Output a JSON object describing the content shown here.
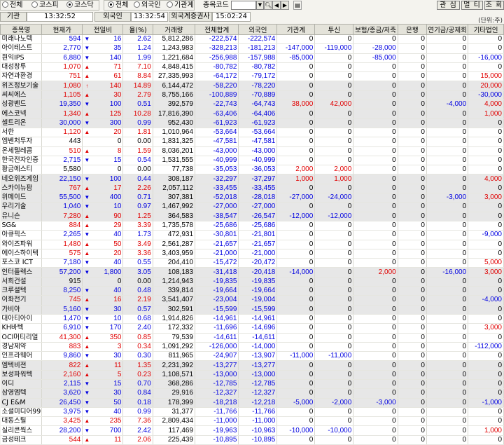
{
  "toolbar": {
    "market_options": [
      "전체",
      "코스피",
      "코스닥"
    ],
    "market_selected": 2,
    "investor_options": [
      "전체",
      "외국인",
      "기관계"
    ],
    "investor_selected": 0,
    "code_label": "종목코드",
    "code_value": "",
    "buttons": [
      "관 심",
      "멀 티",
      "조 회"
    ]
  },
  "timebar": {
    "inst_label": "기관",
    "inst_time": "13:32:52",
    "foreign_label": "외국인",
    "foreign_time": "13:32:54",
    "broker_label": "외국계증권사",
    "broker_time": "15:02:24"
  },
  "unit_label": "(단위:주)",
  "columns": [
    "종목명",
    "현재가",
    "전일비",
    "율(%)",
    "거래량",
    "전체합계",
    "외국인",
    "기관계",
    "투신",
    "보험/종금/저축",
    "은행",
    "연기금/공제회",
    "기타법인"
  ],
  "rows": [
    {
      "name": "미래나노텍",
      "price": "594",
      "dir": "down",
      "chg": "16",
      "rate": "2.62",
      "vol": "5,812,286",
      "total": "-222,574",
      "foreign": "-222,574",
      "inst": "0",
      "trust": "0",
      "ins": "0",
      "bank": "0",
      "pension": "0",
      "etc": "0"
    },
    {
      "name": "아이테스트",
      "price": "2,770",
      "dir": "down",
      "chg": "35",
      "rate": "1.24",
      "vol": "1,243,983",
      "total": "-328,213",
      "foreign": "-181,213",
      "inst": "-147,000",
      "trust": "-119,000",
      "ins": "-28,000",
      "bank": "0",
      "pension": "0",
      "etc": "0"
    },
    {
      "name": "원익IPS",
      "price": "6,880",
      "dir": "down",
      "chg": "140",
      "rate": "1.99",
      "vol": "1,221,684",
      "total": "-256,988",
      "foreign": "-157,988",
      "inst": "-85,000",
      "trust": "0",
      "ins": "-85,000",
      "bank": "0",
      "pension": "0",
      "etc": "-16,000"
    },
    {
      "name": "대성창투",
      "price": "1,070",
      "dir": "up",
      "chg": "71",
      "rate": "7.10",
      "vol": "4,848,415",
      "total": "-80,782",
      "foreign": "-80,782",
      "inst": "0",
      "trust": "0",
      "ins": "0",
      "bank": "0",
      "pension": "0",
      "etc": "0"
    },
    {
      "name": "자연과환경",
      "price": "751",
      "dir": "up",
      "chg": "61",
      "rate": "8.84",
      "vol": "27,335,993",
      "total": "-64,172",
      "foreign": "-79,172",
      "inst": "0",
      "trust": "0",
      "ins": "0",
      "bank": "0",
      "pension": "0",
      "etc": "15,000"
    },
    {
      "name": "위즈정보기술",
      "price": "1,080",
      "dir": "upbig",
      "chg": "140",
      "rate": "14.89",
      "vol": "6,144,472",
      "total": "-58,220",
      "foreign": "-78,220",
      "inst": "0",
      "trust": "0",
      "ins": "0",
      "bank": "0",
      "pension": "0",
      "etc": "20,000"
    },
    {
      "name": "씨씨에스",
      "price": "1,105",
      "dir": "up",
      "chg": "30",
      "rate": "2.79",
      "vol": "8,755,166",
      "total": "-100,889",
      "foreign": "-70,889",
      "inst": "0",
      "trust": "0",
      "ins": "0",
      "bank": "0",
      "pension": "0",
      "etc": "-30,000"
    },
    {
      "name": "성광벤드",
      "price": "19,350",
      "dir": "down",
      "chg": "100",
      "rate": "0.51",
      "vol": "392,579",
      "total": "-22,743",
      "foreign": "-64,743",
      "inst": "38,000",
      "trust": "42,000",
      "ins": "0",
      "bank": "0",
      "pension": "-4,000",
      "etc": "4,000"
    },
    {
      "name": "에스코넥",
      "price": "1,340",
      "dir": "up",
      "chg": "125",
      "rate": "10.28",
      "vol": "17,816,390",
      "total": "-63,406",
      "foreign": "-64,406",
      "inst": "0",
      "trust": "0",
      "ins": "0",
      "bank": "0",
      "pension": "0",
      "etc": "1,000"
    },
    {
      "name": "셀트리온",
      "price": "30,000",
      "dir": "down",
      "chg": "300",
      "rate": "0.99",
      "vol": "952,430",
      "total": "-61,923",
      "foreign": "-61,923",
      "inst": "0",
      "trust": "0",
      "ins": "0",
      "bank": "0",
      "pension": "0",
      "etc": "0"
    },
    {
      "name": "서한",
      "price": "1,120",
      "dir": "up",
      "chg": "20",
      "rate": "1.81",
      "vol": "1,010,964",
      "total": "-53,664",
      "foreign": "-53,664",
      "inst": "0",
      "trust": "0",
      "ins": "0",
      "bank": "0",
      "pension": "0",
      "etc": "0"
    },
    {
      "name": "엠벤처투자",
      "price": "443",
      "dir": "none",
      "chg": "0",
      "rate": "0.00",
      "vol": "1,831,325",
      "total": "-47,581",
      "foreign": "-47,581",
      "inst": "0",
      "trust": "0",
      "ins": "0",
      "bank": "0",
      "pension": "0",
      "etc": "0"
    },
    {
      "name": "온세텔레콤",
      "price": "510",
      "dir": "up",
      "chg": "8",
      "rate": "1.59",
      "vol": "8,036,201",
      "total": "-43,000",
      "foreign": "-43,000",
      "inst": "0",
      "trust": "0",
      "ins": "0",
      "bank": "0",
      "pension": "0",
      "etc": "0"
    },
    {
      "name": "한국전자인증",
      "price": "2,715",
      "dir": "down",
      "chg": "15",
      "rate": "0.54",
      "vol": "1,531,555",
      "total": "-40,999",
      "foreign": "-40,999",
      "inst": "0",
      "trust": "0",
      "ins": "0",
      "bank": "0",
      "pension": "0",
      "etc": "0"
    },
    {
      "name": "황금에스티",
      "price": "5,580",
      "dir": "none",
      "chg": "0",
      "rate": "0.00",
      "vol": "77,738",
      "total": "-35,053",
      "foreign": "-36,053",
      "inst": "2,000",
      "trust": "2,000",
      "ins": "0",
      "bank": "0",
      "pension": "0",
      "etc": "0"
    },
    {
      "name": "네오위즈게임",
      "price": "22,150",
      "dir": "down",
      "chg": "100",
      "rate": "0.44",
      "vol": "308,187",
      "total": "-32,297",
      "foreign": "-37,297",
      "inst": "1,000",
      "trust": "1,000",
      "ins": "0",
      "bank": "0",
      "pension": "0",
      "etc": "4,000"
    },
    {
      "name": "스카이뉴팜",
      "price": "767",
      "dir": "up",
      "chg": "17",
      "rate": "2.26",
      "vol": "2,057,112",
      "total": "-33,455",
      "foreign": "-33,455",
      "inst": "0",
      "trust": "0",
      "ins": "0",
      "bank": "0",
      "pension": "0",
      "etc": "0"
    },
    {
      "name": "위메이드",
      "price": "55,500",
      "dir": "down",
      "chg": "400",
      "rate": "0.71",
      "vol": "307,381",
      "total": "-52,018",
      "foreign": "-28,018",
      "inst": "-27,000",
      "trust": "-24,000",
      "ins": "0",
      "bank": "0",
      "pension": "-3,000",
      "etc": "3,000"
    },
    {
      "name": "우리기술",
      "price": "1,040",
      "dir": "down",
      "chg": "10",
      "rate": "0.97",
      "vol": "1,467,992",
      "total": "-27,000",
      "foreign": "-27,000",
      "inst": "0",
      "trust": "0",
      "ins": "0",
      "bank": "0",
      "pension": "0",
      "etc": "0"
    },
    {
      "name": "유니슨",
      "price": "7,280",
      "dir": "up",
      "chg": "90",
      "rate": "1.25",
      "vol": "364,583",
      "total": "-38,547",
      "foreign": "-26,547",
      "inst": "-12,000",
      "trust": "-12,000",
      "ins": "0",
      "bank": "0",
      "pension": "0",
      "etc": "0"
    },
    {
      "name": "SG&",
      "price": "884",
      "dir": "up",
      "chg": "29",
      "rate": "3.39",
      "vol": "1,735,578",
      "total": "-25,686",
      "foreign": "-25,686",
      "inst": "0",
      "trust": "0",
      "ins": "0",
      "bank": "0",
      "pension": "0",
      "etc": "0"
    },
    {
      "name": "아큐픽스",
      "price": "2,265",
      "dir": "down",
      "chg": "40",
      "rate": "1.73",
      "vol": "472,931",
      "total": "-30,801",
      "foreign": "-21,801",
      "inst": "0",
      "trust": "0",
      "ins": "0",
      "bank": "0",
      "pension": "0",
      "etc": "-9,000"
    },
    {
      "name": "와이즈파워",
      "price": "1,480",
      "dir": "up",
      "chg": "50",
      "rate": "3.49",
      "vol": "2,561,287",
      "total": "-21,657",
      "foreign": "-21,657",
      "inst": "0",
      "trust": "0",
      "ins": "0",
      "bank": "0",
      "pension": "0",
      "etc": "0"
    },
    {
      "name": "에이스하이텍",
      "price": "575",
      "dir": "up",
      "chg": "20",
      "rate": "3.36",
      "vol": "3,403,959",
      "total": "-21,000",
      "foreign": "-21,000",
      "inst": "0",
      "trust": "0",
      "ins": "0",
      "bank": "0",
      "pension": "0",
      "etc": "0"
    },
    {
      "name": "포스코 ICT",
      "price": "7,180",
      "dir": "down",
      "chg": "40",
      "rate": "0.55",
      "vol": "204,410",
      "total": "-15,472",
      "foreign": "-20,472",
      "inst": "0",
      "trust": "0",
      "ins": "0",
      "bank": "0",
      "pension": "0",
      "etc": "5,000"
    },
    {
      "name": "인터플렉스",
      "price": "57,200",
      "dir": "down",
      "chg": "1,800",
      "rate": "3.05",
      "vol": "108,183",
      "total": "-31,418",
      "foreign": "-20,418",
      "inst": "-14,000",
      "trust": "0",
      "ins": "2,000",
      "bank": "0",
      "pension": "-16,000",
      "etc": "3,000"
    },
    {
      "name": "서희건설",
      "price": "915",
      "dir": "none",
      "chg": "0",
      "rate": "0.00",
      "vol": "1,214,943",
      "total": "-19,835",
      "foreign": "-19,835",
      "inst": "0",
      "trust": "0",
      "ins": "0",
      "bank": "0",
      "pension": "0",
      "etc": "0"
    },
    {
      "name": "크루셜텍",
      "price": "8,250",
      "dir": "down",
      "chg": "40",
      "rate": "0.48",
      "vol": "339,814",
      "total": "-19,664",
      "foreign": "-19,664",
      "inst": "0",
      "trust": "0",
      "ins": "0",
      "bank": "0",
      "pension": "0",
      "etc": "0"
    },
    {
      "name": "이화전기",
      "price": "745",
      "dir": "up",
      "chg": "16",
      "rate": "2.19",
      "vol": "3,541,407",
      "total": "-23,004",
      "foreign": "-19,004",
      "inst": "0",
      "trust": "0",
      "ins": "0",
      "bank": "0",
      "pension": "0",
      "etc": "-4,000"
    },
    {
      "name": "가비아",
      "price": "5,160",
      "dir": "down",
      "chg": "30",
      "rate": "0.57",
      "vol": "302,591",
      "total": "-15,599",
      "foreign": "-15,599",
      "inst": "0",
      "trust": "0",
      "ins": "0",
      "bank": "0",
      "pension": "0",
      "etc": "0"
    },
    {
      "name": "대아티아이",
      "price": "1,470",
      "dir": "down",
      "chg": "10",
      "rate": "0.68",
      "vol": "1,914,826",
      "total": "-14,961",
      "foreign": "-14,961",
      "inst": "0",
      "trust": "0",
      "ins": "0",
      "bank": "0",
      "pension": "0",
      "etc": "0"
    },
    {
      "name": "KH바텍",
      "price": "6,910",
      "dir": "down",
      "chg": "170",
      "rate": "2.40",
      "vol": "172,332",
      "total": "-11,696",
      "foreign": "-14,696",
      "inst": "0",
      "trust": "0",
      "ins": "0",
      "bank": "0",
      "pension": "0",
      "etc": "3,000"
    },
    {
      "name": "OCI머티리얼",
      "price": "41,300",
      "dir": "up",
      "chg": "350",
      "rate": "0.85",
      "vol": "79,539",
      "total": "-14,611",
      "foreign": "-14,611",
      "inst": "0",
      "trust": "0",
      "ins": "0",
      "bank": "0",
      "pension": "0",
      "etc": "0"
    },
    {
      "name": "경남제약",
      "price": "883",
      "dir": "up",
      "chg": "3",
      "rate": "0.34",
      "vol": "1,091,292",
      "total": "-126,000",
      "foreign": "-14,000",
      "inst": "0",
      "trust": "0",
      "ins": "0",
      "bank": "0",
      "pension": "0",
      "etc": "-112,000"
    },
    {
      "name": "인프라웨어",
      "price": "9,860",
      "dir": "down",
      "chg": "30",
      "rate": "0.30",
      "vol": "811,965",
      "total": "-24,907",
      "foreign": "-13,907",
      "inst": "-11,000",
      "trust": "-11,000",
      "ins": "0",
      "bank": "0",
      "pension": "0",
      "etc": "0"
    },
    {
      "name": "엠텍비젼",
      "price": "822",
      "dir": "up",
      "chg": "11",
      "rate": "1.35",
      "vol": "2,231,392",
      "total": "-13,277",
      "foreign": "-13,277",
      "inst": "0",
      "trust": "0",
      "ins": "0",
      "bank": "0",
      "pension": "0",
      "etc": "0"
    },
    {
      "name": "보성파워텍",
      "price": "2,160",
      "dir": "up",
      "chg": "5",
      "rate": "0.23",
      "vol": "1,108,571",
      "total": "-13,000",
      "foreign": "-13,000",
      "inst": "0",
      "trust": "0",
      "ins": "0",
      "bank": "0",
      "pension": "0",
      "etc": "0"
    },
    {
      "name": "이디",
      "price": "2,115",
      "dir": "down",
      "chg": "15",
      "rate": "0.70",
      "vol": "368,286",
      "total": "-12,785",
      "foreign": "-12,785",
      "inst": "0",
      "trust": "0",
      "ins": "0",
      "bank": "0",
      "pension": "0",
      "etc": "0"
    },
    {
      "name": "삼영엠텍",
      "price": "3,620",
      "dir": "down",
      "chg": "30",
      "rate": "0.84",
      "vol": "29,916",
      "total": "-12,327",
      "foreign": "-12,327",
      "inst": "0",
      "trust": "0",
      "ins": "0",
      "bank": "0",
      "pension": "0",
      "etc": "0"
    },
    {
      "name": "CJ E&M",
      "price": "26,450",
      "dir": "down",
      "chg": "50",
      "rate": "0.18",
      "vol": "178,399",
      "total": "-18,218",
      "foreign": "-12,218",
      "inst": "-5,000",
      "trust": "-2,000",
      "ins": "-3,000",
      "bank": "0",
      "pension": "0",
      "etc": "-1,000"
    },
    {
      "name": "소셜미디어99",
      "price": "3,975",
      "dir": "down",
      "chg": "40",
      "rate": "0.99",
      "vol": "31,377",
      "total": "-11,766",
      "foreign": "-11,766",
      "inst": "0",
      "trust": "0",
      "ins": "0",
      "bank": "0",
      "pension": "0",
      "etc": "0"
    },
    {
      "name": "대동스틸",
      "price": "3,425",
      "dir": "up",
      "chg": "235",
      "rate": "7.36",
      "vol": "2,809,434",
      "total": "-11,000",
      "foreign": "-11,000",
      "inst": "0",
      "trust": "0",
      "ins": "0",
      "bank": "0",
      "pension": "0",
      "etc": "0"
    },
    {
      "name": "실리콘웍스",
      "price": "28,200",
      "dir": "down",
      "chg": "700",
      "rate": "2.42",
      "vol": "117,469",
      "total": "-19,963",
      "foreign": "-10,963",
      "inst": "-10,000",
      "trust": "-10,000",
      "ins": "0",
      "bank": "0",
      "pension": "0",
      "etc": "1,000"
    },
    {
      "name": "금성테크",
      "price": "544",
      "dir": "up",
      "chg": "11",
      "rate": "2.06",
      "vol": "225,439",
      "total": "-10,895",
      "foreign": "-10,895",
      "inst": "0",
      "trust": "0",
      "ins": "0",
      "bank": "0",
      "pension": "0",
      "etc": "0"
    }
  ]
}
